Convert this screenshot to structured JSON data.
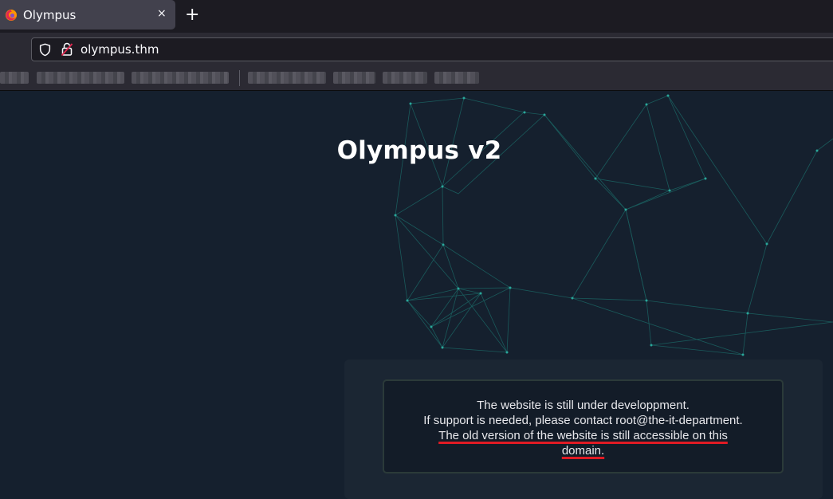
{
  "browser": {
    "tab": {
      "title": "Olympus",
      "close_glyph": "×",
      "favicon": "firefox-favicon"
    },
    "new_tab_glyph": "+",
    "address_bar": {
      "url": "olympus.thm",
      "shield_icon": "shield-icon",
      "lock_icon": "insecure-lock-icon"
    }
  },
  "page": {
    "title": "Olympus v2",
    "notice": {
      "line1": "The website is still under developpment.",
      "line2": "If support is needed, please contact root@the-it-department.",
      "line3": "The old version of the website is still accessible on this",
      "line4": "domain."
    }
  },
  "colors": {
    "page_bg": "#15202e",
    "network_lines": "#1e8a80",
    "underline_annotation": "#e01b24"
  }
}
